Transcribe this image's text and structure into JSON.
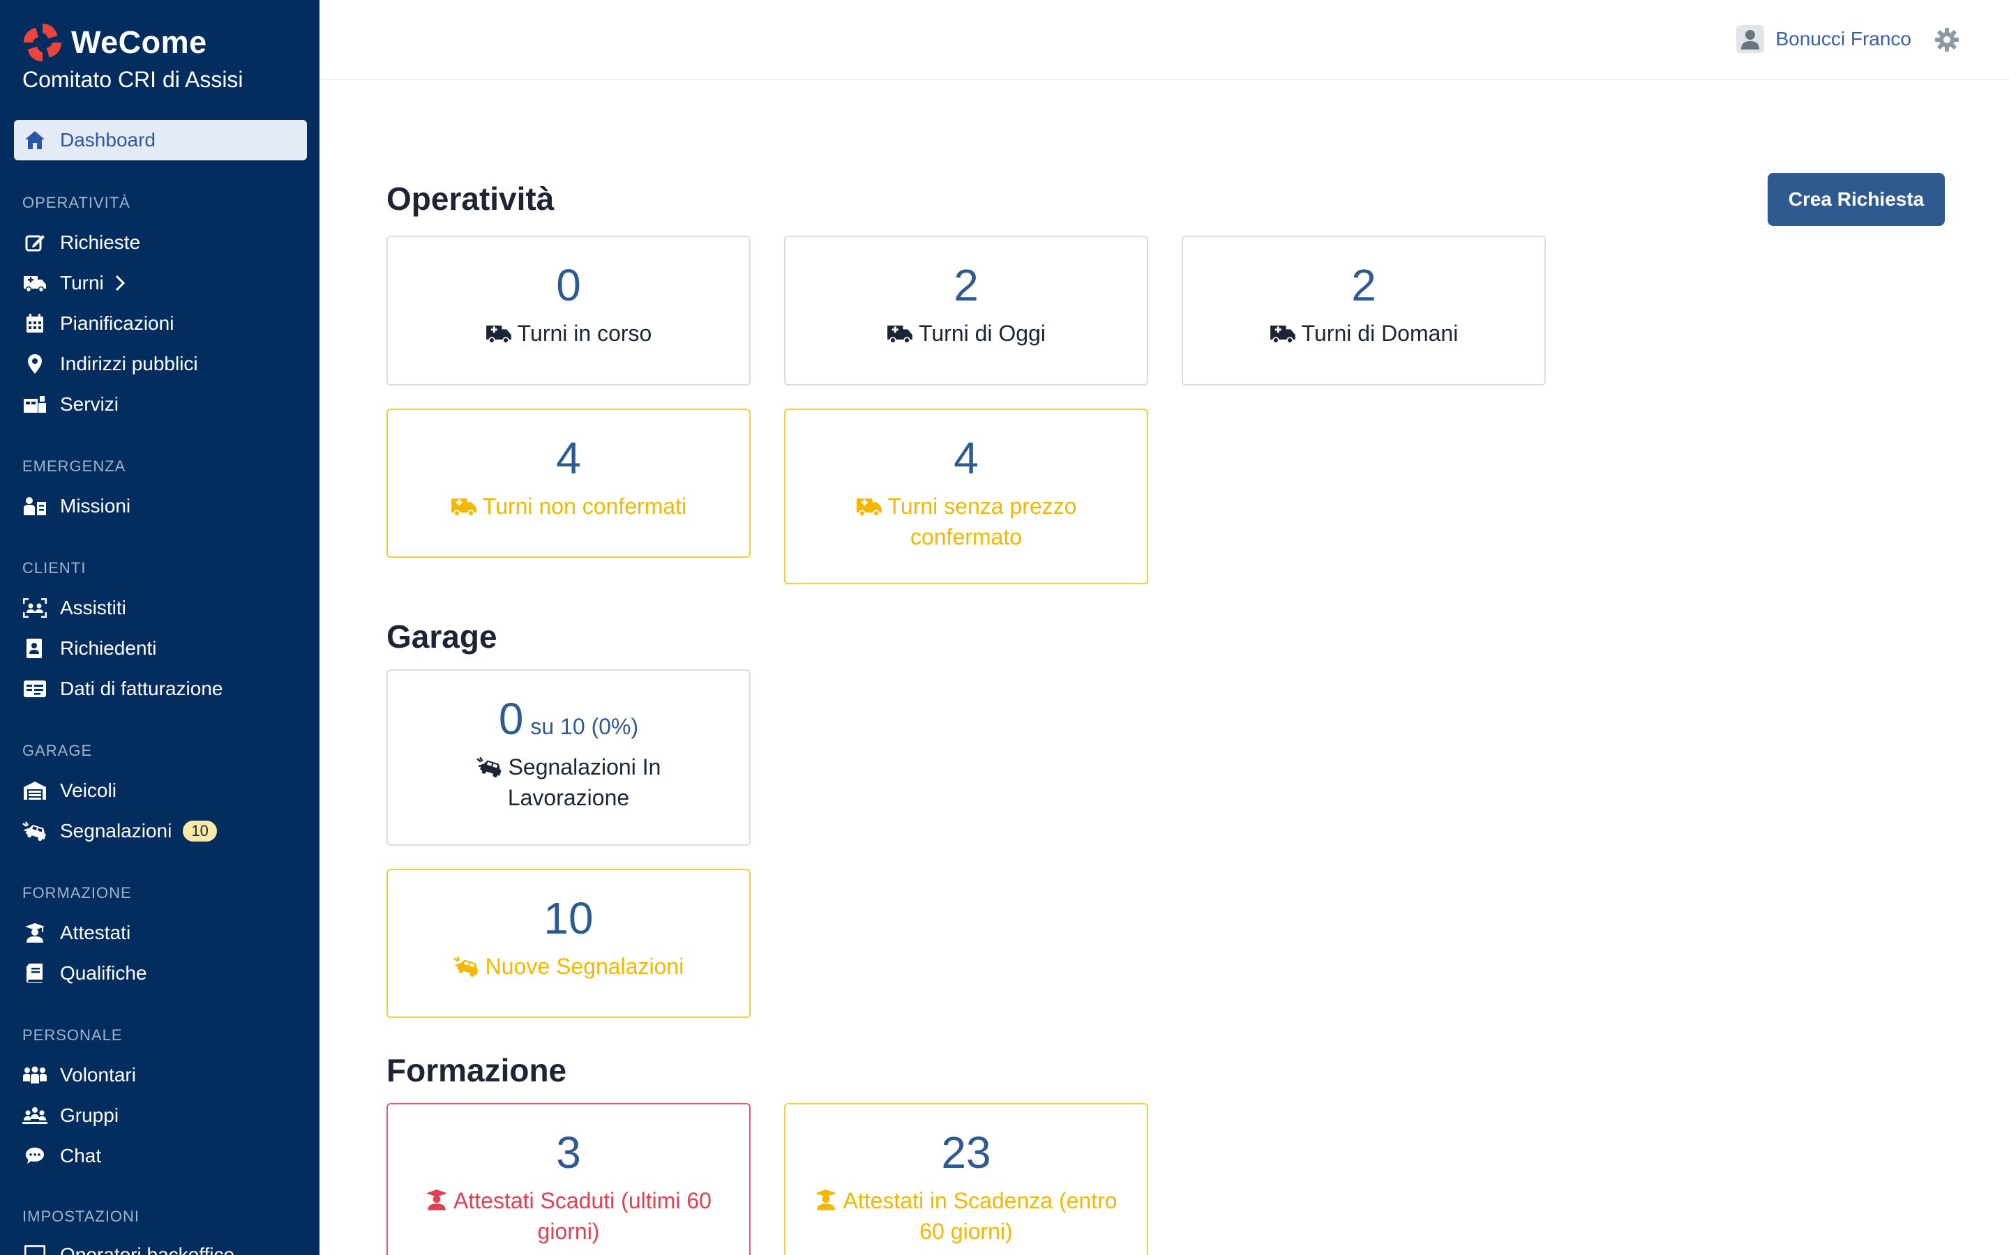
{
  "brand": {
    "name": "WeCome",
    "org": "Comitato CRI di Assisi"
  },
  "sidebar": {
    "dashboard": "Dashboard",
    "sections": [
      {
        "title": "OPERATIVITÀ",
        "items": [
          {
            "label": "Richieste",
            "icon": "edit-icon"
          },
          {
            "label": "Turni",
            "icon": "ambulance-icon",
            "has_chevron": true
          },
          {
            "label": "Pianificazioni",
            "icon": "calendar-icon"
          },
          {
            "label": "Indirizzi pubblici",
            "icon": "map-pin-icon"
          },
          {
            "label": "Servizi",
            "icon": "services-icon"
          }
        ]
      },
      {
        "title": "EMERGENZA",
        "items": [
          {
            "label": "Missioni",
            "icon": "mission-icon"
          }
        ]
      },
      {
        "title": "CLIENTI",
        "items": [
          {
            "label": "Assistiti",
            "icon": "people-scan-icon"
          },
          {
            "label": "Richiedenti",
            "icon": "contact-book-icon"
          },
          {
            "label": "Dati di fatturazione",
            "icon": "id-card-icon"
          }
        ]
      },
      {
        "title": "GARAGE",
        "items": [
          {
            "label": "Veicoli",
            "icon": "garage-icon"
          },
          {
            "label": "Segnalazioni",
            "icon": "car-crash-icon",
            "badge": "10"
          }
        ]
      },
      {
        "title": "FORMAZIONE",
        "items": [
          {
            "label": "Attestati",
            "icon": "graduate-icon"
          },
          {
            "label": "Qualifiche",
            "icon": "book-icon"
          }
        ]
      },
      {
        "title": "PERSONALE",
        "items": [
          {
            "label": "Volontari",
            "icon": "users-icon"
          },
          {
            "label": "Gruppi",
            "icon": "group-icon"
          },
          {
            "label": "Chat",
            "icon": "chat-icon"
          }
        ]
      },
      {
        "title": "IMPOSTAZIONI",
        "items": [
          {
            "label": "Operatori backoffice",
            "icon": "operator-icon"
          }
        ]
      }
    ]
  },
  "topbar": {
    "user_name": "Bonucci Franco"
  },
  "main": {
    "create_button": "Crea Richiesta",
    "operativita": {
      "title": "Operatività",
      "cards": [
        {
          "value": "0",
          "label": "Turni in corso",
          "style": "normal"
        },
        {
          "value": "2",
          "label": "Turni di Oggi",
          "style": "normal"
        },
        {
          "value": "2",
          "label": "Turni di Domani",
          "style": "normal"
        },
        {
          "value": "4",
          "label": "Turni non confermati",
          "style": "warn"
        },
        {
          "value": "4",
          "label": "Turni senza prezzo confermato",
          "style": "warn"
        }
      ]
    },
    "garage": {
      "title": "Garage",
      "cards": [
        {
          "value": "0",
          "suffix": "su 10 (0%)",
          "label": "Segnalazioni In Lavorazione",
          "style": "normal"
        },
        {
          "value": "10",
          "label": "Nuove Segnalazioni",
          "style": "warn"
        }
      ]
    },
    "formazione": {
      "title": "Formazione",
      "cards": [
        {
          "value": "3",
          "label": "Attestati Scaduti (ultimi 60 giorni)",
          "style": "danger"
        },
        {
          "value": "23",
          "label": "Attestati in Scadenza (entro 60 giorni)",
          "style": "warn"
        }
      ]
    }
  },
  "colors": {
    "sidebar": "#042d5f",
    "accent": "#2e5a8f",
    "warn": "#f2b800",
    "danger": "#e04050"
  }
}
